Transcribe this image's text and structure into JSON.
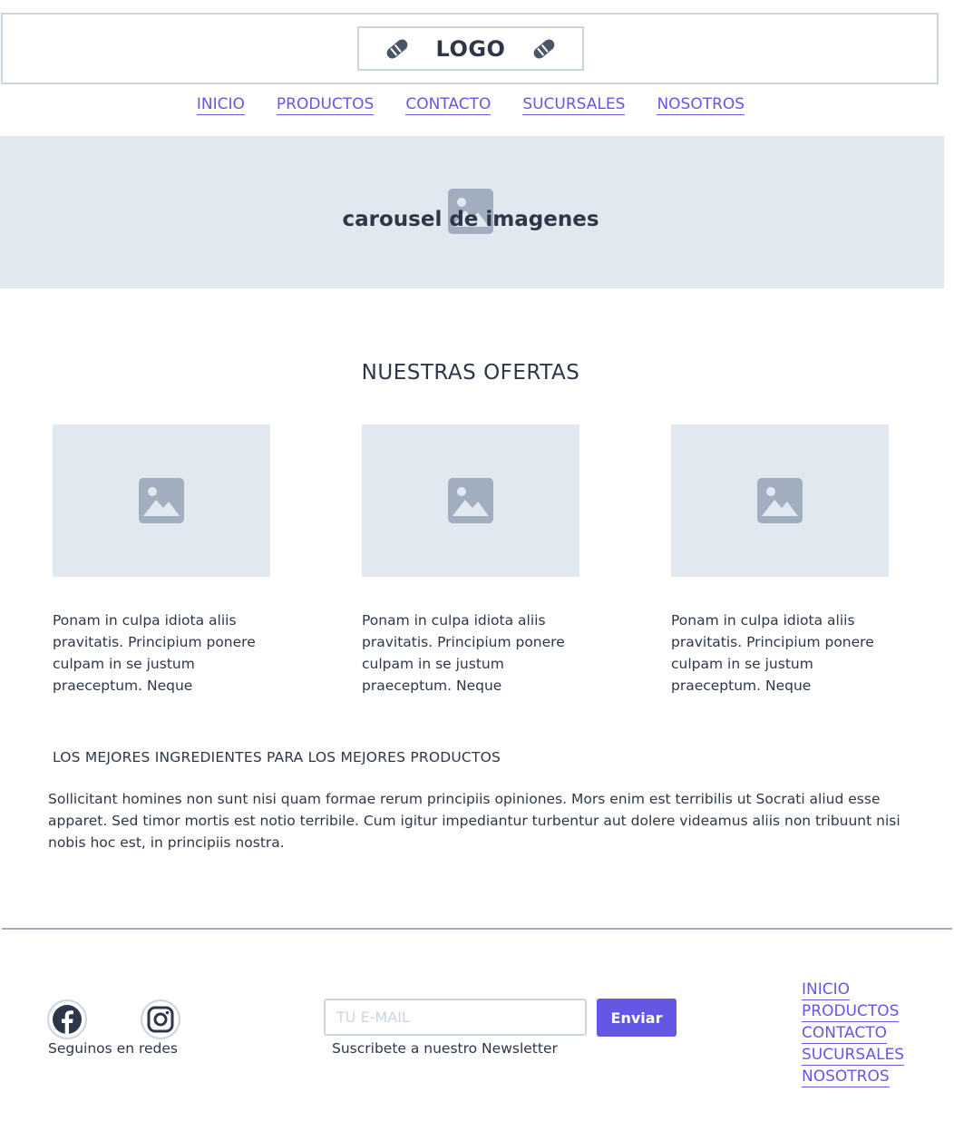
{
  "header": {
    "logo_text": "LOGO",
    "logo_icons": [
      "bread-icon",
      "bread-icon"
    ]
  },
  "nav": {
    "items": [
      {
        "label": "INICIO"
      },
      {
        "label": "PRODUCTOS"
      },
      {
        "label": "CONTACTO"
      },
      {
        "label": "SUCURSALES"
      },
      {
        "label": "NOSOTROS"
      }
    ]
  },
  "carousel": {
    "text": "carousel de imagenes",
    "icon": "image-placeholder-icon"
  },
  "ofertas": {
    "title": "NUESTRAS OFERTAS",
    "cards": [
      {
        "text": "Ponam in culpa idiota aliis pravitatis. Principium ponere culpam in se justum praeceptum. Neque",
        "icon": "image-placeholder-icon"
      },
      {
        "text": "Ponam in culpa idiota aliis pravitatis. Principium ponere culpam in se justum praeceptum. Neque",
        "icon": "image-placeholder-icon"
      },
      {
        "text": "Ponam in culpa idiota aliis pravitatis. Principium ponere culpam in se justum praeceptum. Neque",
        "icon": "image-placeholder-icon"
      }
    ]
  },
  "ingredientes": {
    "title": "LOS MEJORES INGREDIENTES PARA LOS MEJORES PRODUCTOS",
    "text": "Sollicitant homines non sunt nisi quam formae rerum principiis opiniones. Mors enim est terribilis ut Socrati aliud esse apparet. Sed timor mortis est notio terribile. Cum igitur impediantur turbentur aut dolere videamus aliis non tribuunt nisi nobis hoc est, in principiis nostra."
  },
  "footer": {
    "social": {
      "icons": [
        "facebook-icon",
        "instagram-icon"
      ],
      "label": "Seguinos en redes"
    },
    "newsletter": {
      "placeholder": "TU E-MAIL",
      "value": "",
      "button_label": "Enviar",
      "caption": "Suscribete a nuestro Newsletter"
    },
    "links": [
      {
        "label": "INICIO"
      },
      {
        "label": "PRODUCTOS"
      },
      {
        "label": "CONTACTO"
      },
      {
        "label": "SUCURSALES"
      },
      {
        "label": "NOSOTROS"
      }
    ]
  },
  "colors": {
    "accent": "#6457e6",
    "placeholder_bg": "#e2e8f0",
    "border": "#cbd5e0",
    "text": "#2d3748"
  }
}
